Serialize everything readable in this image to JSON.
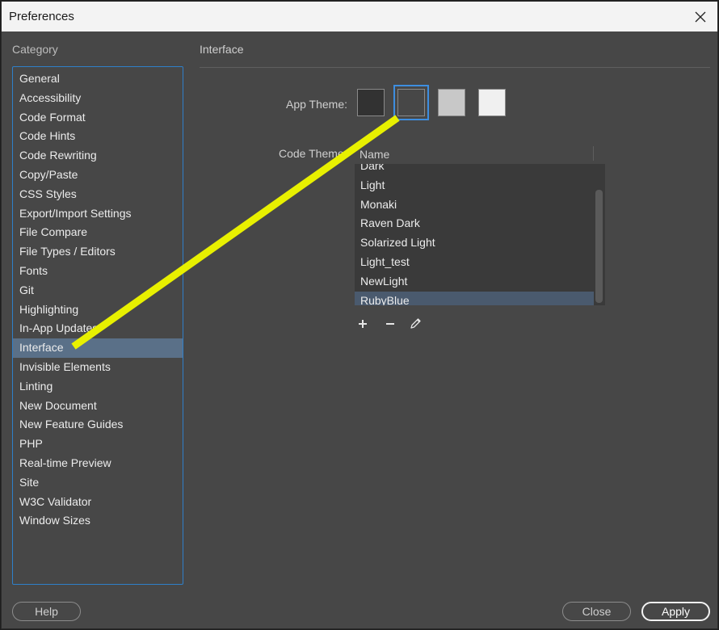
{
  "window": {
    "title": "Preferences"
  },
  "sidebar": {
    "label": "Category",
    "items": [
      {
        "label": "General"
      },
      {
        "label": "Accessibility"
      },
      {
        "label": "Code Format"
      },
      {
        "label": "Code Hints"
      },
      {
        "label": "Code Rewriting"
      },
      {
        "label": "Copy/Paste"
      },
      {
        "label": "CSS Styles"
      },
      {
        "label": "Export/Import Settings"
      },
      {
        "label": "File Compare"
      },
      {
        "label": "File Types / Editors"
      },
      {
        "label": "Fonts"
      },
      {
        "label": "Git"
      },
      {
        "label": "Highlighting"
      },
      {
        "label": "In-App Updates"
      },
      {
        "label": "Interface"
      },
      {
        "label": "Invisible Elements"
      },
      {
        "label": "Linting"
      },
      {
        "label": "New Document"
      },
      {
        "label": "New Feature Guides"
      },
      {
        "label": "PHP"
      },
      {
        "label": "Real-time Preview"
      },
      {
        "label": "Site"
      },
      {
        "label": "W3C Validator"
      },
      {
        "label": "Window Sizes"
      }
    ],
    "selected": "Interface"
  },
  "main": {
    "section_title": "Interface",
    "app_theme": {
      "label": "App Theme:",
      "swatches": [
        {
          "name": "darkest",
          "color": "#323232"
        },
        {
          "name": "dark",
          "color": "#474747"
        },
        {
          "name": "light",
          "color": "#c8c8c8"
        },
        {
          "name": "lightest",
          "color": "#f0f0f0"
        }
      ],
      "selected_index": 1
    },
    "code_theme": {
      "label": "Code Theme:",
      "column_header": "Name",
      "items": [
        {
          "label": "Dark"
        },
        {
          "label": "Light"
        },
        {
          "label": "Monaki"
        },
        {
          "label": "Raven Dark"
        },
        {
          "label": "Solarized Light"
        },
        {
          "label": "Light_test"
        },
        {
          "label": "NewLight"
        },
        {
          "label": "RubyBlue"
        }
      ],
      "selected": "RubyBlue"
    },
    "tools": {
      "add_icon": "plus-icon",
      "remove_icon": "minus-icon",
      "edit_icon": "pencil-icon"
    }
  },
  "footer": {
    "help_label": "Help",
    "close_label": "Close",
    "apply_label": "Apply"
  },
  "colors": {
    "accent": "#2f7fc9",
    "selection": "#5a7088",
    "annotation": "#e8f000"
  }
}
